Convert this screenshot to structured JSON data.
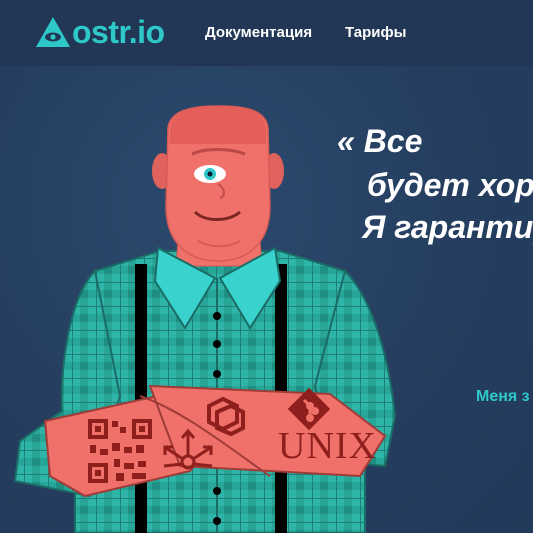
{
  "header": {
    "logo_text": "ostr.io",
    "nav": [
      {
        "label": "Документация"
      },
      {
        "label": "Тарифы"
      }
    ]
  },
  "hero": {
    "quote_lines": [
      "« Все",
      "будет хор",
      "Я гарантир"
    ],
    "subtitle": "Меня з",
    "tattoo_text": "UNIX"
  },
  "colors": {
    "header_bg": "#213755",
    "hero_bg": "#253e5f",
    "accent": "#2ec8c8",
    "skin": "#f0706a",
    "shirt": "#2fb5a8"
  },
  "icons": [
    "eye-pyramid-logo-icon",
    "qr-code-icon",
    "network-arrows-icon",
    "git-icon",
    "puzzle-logo-icon"
  ]
}
